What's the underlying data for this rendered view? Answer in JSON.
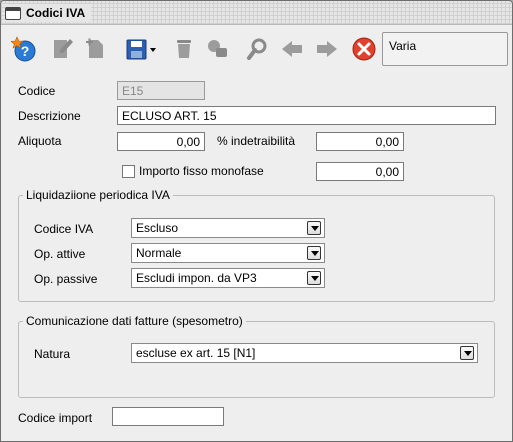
{
  "window": {
    "title": "Codici IVA"
  },
  "toolbar": {
    "icons": [
      "help-star-icon",
      "edit-icon",
      "new-document-icon",
      "save-icon",
      "delete-icon",
      "duplicate-icon",
      "search-icon",
      "previous-icon",
      "next-icon",
      "close-icon"
    ],
    "varia_label": "Varia"
  },
  "form": {
    "codice_label": "Codice",
    "codice_value": "E15",
    "descrizione_label": "Descrizione",
    "descrizione_value": "ECLUSO ART. 15",
    "aliquota_label": "Aliquota",
    "aliquota_value": "0,00",
    "indetraibilita_label": "% indetraibilità",
    "indetraibilita_value": "0,00",
    "importo_fisso_label": "Importo fisso monofase",
    "importo_fisso_checked": false,
    "importo_fisso_value": "0,00",
    "codice_import_label": "Codice import",
    "codice_import_value": ""
  },
  "liquidazione": {
    "title": "Liquidaziione periodica IVA",
    "codice_iva_label": "Codice IVA",
    "codice_iva_value": "Escluso",
    "op_attive_label": "Op. attive",
    "op_attive_value": "Normale",
    "op_passive_label": "Op. passive",
    "op_passive_value": "Escludi impon. da VP3"
  },
  "comunicazione": {
    "title": "Comunicazione dati fatture (spesometro)",
    "natura_label": "Natura",
    "natura_value": "escluse ex art. 15 [N1]"
  }
}
